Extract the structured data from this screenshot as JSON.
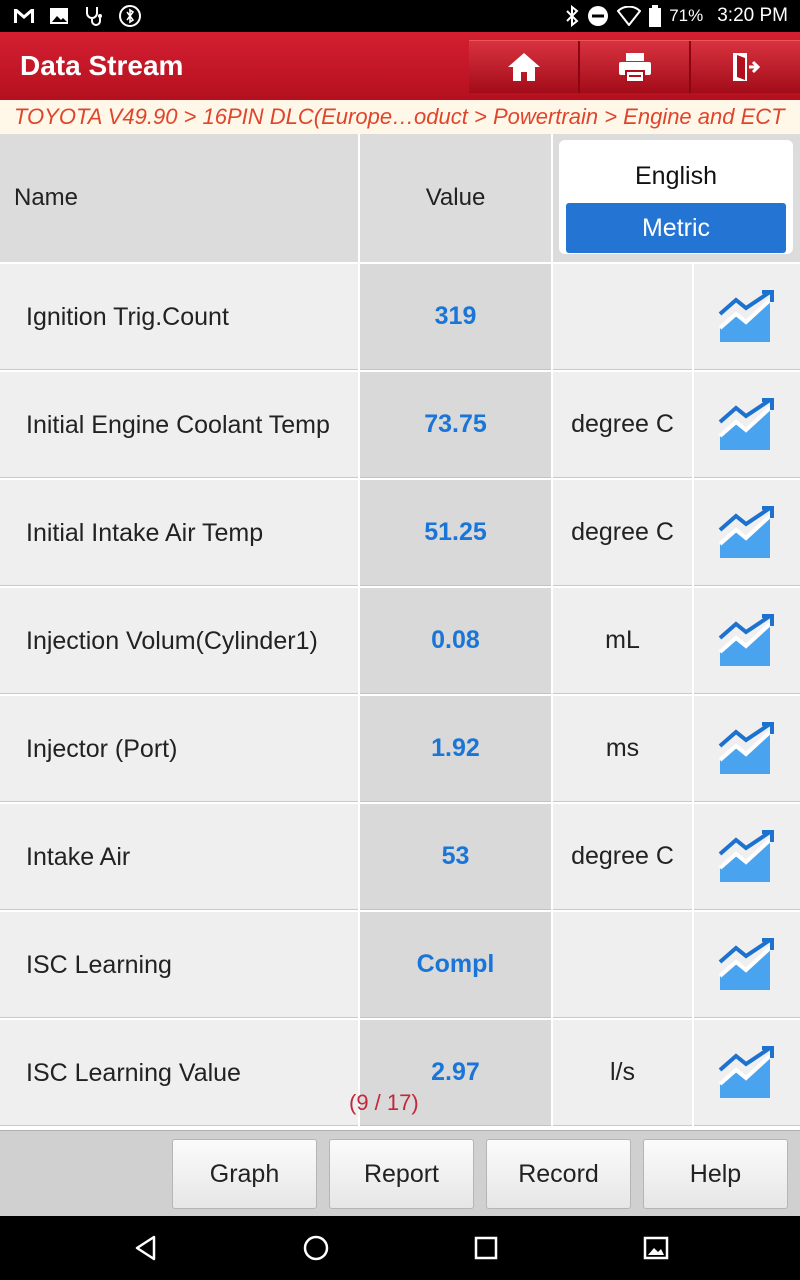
{
  "status": {
    "battery": "71%",
    "time": "3:20 PM"
  },
  "app": {
    "title": "Data Stream"
  },
  "breadcrumb": "TOYOTA V49.90 > 16PIN DLC(Europe…oduct > Powertrain > Engine and ECT",
  "table": {
    "header_name": "Name",
    "header_value": "Value",
    "unit_english": "English",
    "unit_metric": "Metric",
    "rows": [
      {
        "name": "Ignition Trig.Count",
        "value": "319",
        "unit": ""
      },
      {
        "name": "Initial Engine Coolant Temp",
        "value": "73.75",
        "unit": "degree C"
      },
      {
        "name": "Initial Intake Air Temp",
        "value": "51.25",
        "unit": "degree C"
      },
      {
        "name": "Injection Volum(Cylinder1)",
        "value": "0.08",
        "unit": "mL"
      },
      {
        "name": "Injector (Port)",
        "value": "1.92",
        "unit": "ms"
      },
      {
        "name": "Intake Air",
        "value": "53",
        "unit": "degree C"
      },
      {
        "name": "ISC Learning",
        "value": "Compl",
        "unit": ""
      },
      {
        "name": "ISC Learning Value",
        "value": "2.97",
        "unit": "l/s"
      }
    ]
  },
  "pager": "(9 / 17)",
  "toolbar": {
    "graph": "Graph",
    "report": "Report",
    "record": "Record",
    "help": "Help"
  },
  "colors": {
    "brand_red": "#c8192a",
    "value_blue": "#1a75d8",
    "toggle_blue": "#2474d3"
  }
}
